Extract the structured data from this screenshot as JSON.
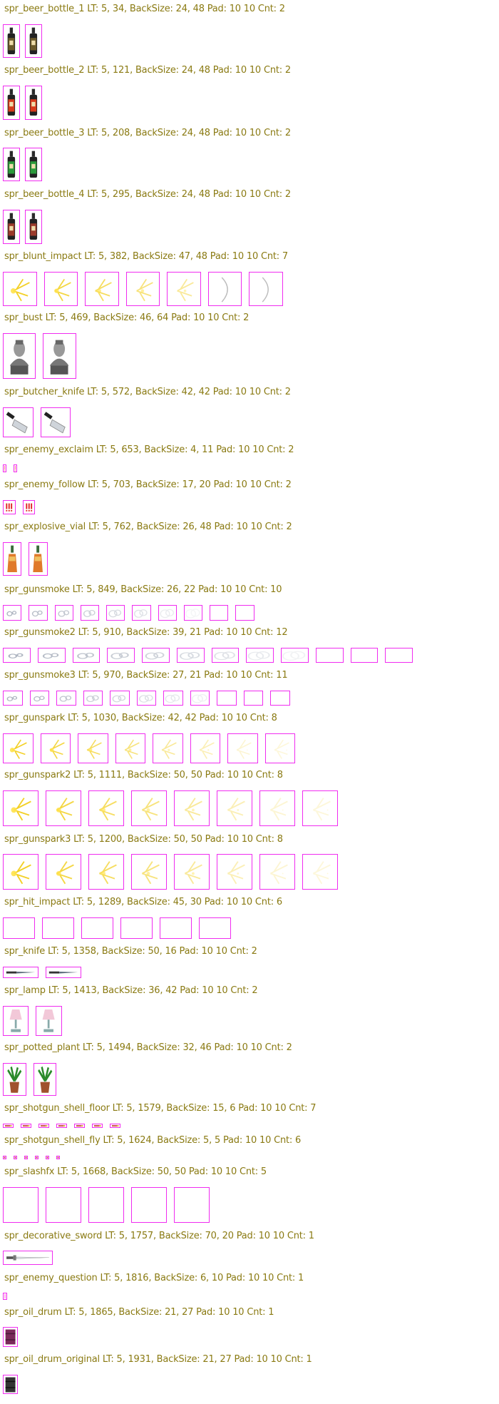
{
  "palette": {
    "label": "#8a7a12",
    "frame_border": "#f02cf0",
    "background": "#ffffff"
  },
  "sprites": [
    {
      "label": "spr_beer_bottle_1  LT: 5, 34,  BackSize: 24, 48  Pad: 10 10 Cnt: 2",
      "icon": "beer-bottle-dark-icon",
      "count": 2
    },
    {
      "label": "spr_beer_bottle_2  LT: 5, 121,  BackSize: 24, 48  Pad: 10 10 Cnt: 2",
      "icon": "beer-bottle-red-icon",
      "count": 2
    },
    {
      "label": "spr_beer_bottle_3  LT: 5, 208,  BackSize: 24, 48  Pad: 10 10 Cnt: 2",
      "icon": "beer-bottle-green-icon",
      "count": 2
    },
    {
      "label": "spr_beer_bottle_4  LT: 5, 295,  BackSize: 24, 48  Pad: 10 10 Cnt: 2",
      "icon": "beer-bottle-brown-icon",
      "count": 2
    },
    {
      "label": "spr_blunt_impact  LT: 5, 382,  BackSize: 47, 48  Pad: 10 10 Cnt: 7",
      "icon": "impact-spark-icon",
      "count": 7
    },
    {
      "label": "spr_bust  LT: 5, 469,  BackSize: 46, 64  Pad: 10 10 Cnt: 2",
      "icon": "bust-statue-icon",
      "count": 2
    },
    {
      "label": "spr_butcher_knife  LT: 5, 572,  BackSize: 42, 42  Pad: 10 10 Cnt: 2",
      "icon": "butcher-knife-icon",
      "count": 2
    },
    {
      "label": "spr_enemy_exclaim  LT: 5, 653,  BackSize: 4, 11  Pad: 10 10 Cnt: 2",
      "icon": "exclaim-icon",
      "count": 2
    },
    {
      "label": "spr_enemy_follow  LT: 5, 703,  BackSize: 17, 20  Pad: 10 10 Cnt: 2",
      "icon": "follow-marks-icon",
      "count": 2
    },
    {
      "label": "spr_explosive_vial  LT: 5, 762,  BackSize: 26, 48  Pad: 10 10 Cnt: 2",
      "icon": "explosive-vial-icon",
      "count": 2
    },
    {
      "label": "spr_gunsmoke  LT: 5, 849,  BackSize: 26, 22  Pad: 10 10 Cnt: 10",
      "icon": "smoke-puff-icon",
      "count": 10
    },
    {
      "label": "spr_gunsmoke2  LT: 5, 910,  BackSize: 39, 21  Pad: 10 10 Cnt: 12",
      "icon": "smoke-puff-icon",
      "count": 12
    },
    {
      "label": "spr_gunsmoke3  LT: 5, 970,  BackSize: 27, 21  Pad: 10 10 Cnt: 11",
      "icon": "smoke-puff-icon",
      "count": 11
    },
    {
      "label": "spr_gunspark  LT: 5, 1030,  BackSize: 42, 42  Pad: 10 10 Cnt: 8",
      "icon": "gun-spark-icon",
      "count": 8
    },
    {
      "label": "spr_gunspark2  LT: 5, 1111,  BackSize: 50, 50  Pad: 10 10 Cnt: 8",
      "icon": "gun-spark-icon",
      "count": 8
    },
    {
      "label": "spr_gunspark3  LT: 5, 1200,  BackSize: 50, 50  Pad: 10 10 Cnt: 8",
      "icon": "gun-spark-icon",
      "count": 8
    },
    {
      "label": "spr_hit_impact  LT: 5, 1289,  BackSize: 45, 30  Pad: 10 10 Cnt: 6",
      "icon": "empty-frame",
      "count": 6
    },
    {
      "label": "spr_knife  LT: 5, 1358,  BackSize: 50, 16  Pad: 10 10 Cnt: 2",
      "icon": "knife-icon",
      "count": 2
    },
    {
      "label": "spr_lamp  LT: 5, 1413,  BackSize: 36, 42  Pad: 10 10 Cnt: 2",
      "icon": "lamp-icon",
      "count": 2
    },
    {
      "label": "spr_potted_plant  LT: 5, 1494,  BackSize: 32, 46  Pad: 10 10 Cnt: 2",
      "icon": "potted-plant-icon",
      "count": 2
    },
    {
      "label": "spr_shotgun_shell_floor  LT: 5, 1579,  BackSize: 15, 6  Pad: 10 10 Cnt: 7",
      "icon": "shell-icon",
      "count": 7
    },
    {
      "label": "spr_shotgun_shell_fly  LT: 5, 1624,  BackSize: 5, 5  Pad: 10 10 Cnt: 6",
      "icon": "shell-dot-icon",
      "count": 6
    },
    {
      "label": "spr_slashfx  LT: 5, 1668,  BackSize: 50, 50  Pad: 10 10 Cnt: 5",
      "icon": "empty-frame",
      "count": 5
    },
    {
      "label": "spr_decorative_sword  LT: 5, 1757,  BackSize: 70, 20  Pad: 10 10 Cnt: 1",
      "icon": "sword-icon",
      "count": 1
    },
    {
      "label": "spr_enemy_question  LT: 5, 1816,  BackSize: 6, 10  Pad: 10 10 Cnt: 1",
      "icon": "question-icon",
      "count": 1
    },
    {
      "label": "spr_oil_drum  LT: 5, 1865,  BackSize: 21, 27  Pad: 10 10 Cnt: 1",
      "icon": "oil-drum-icon",
      "count": 1
    },
    {
      "label": "spr_oil_drum_original  LT: 5, 1931,  BackSize: 21, 27  Pad: 10 10 Cnt: 1",
      "icon": "oil-drum-dark-icon",
      "count": 1
    }
  ]
}
